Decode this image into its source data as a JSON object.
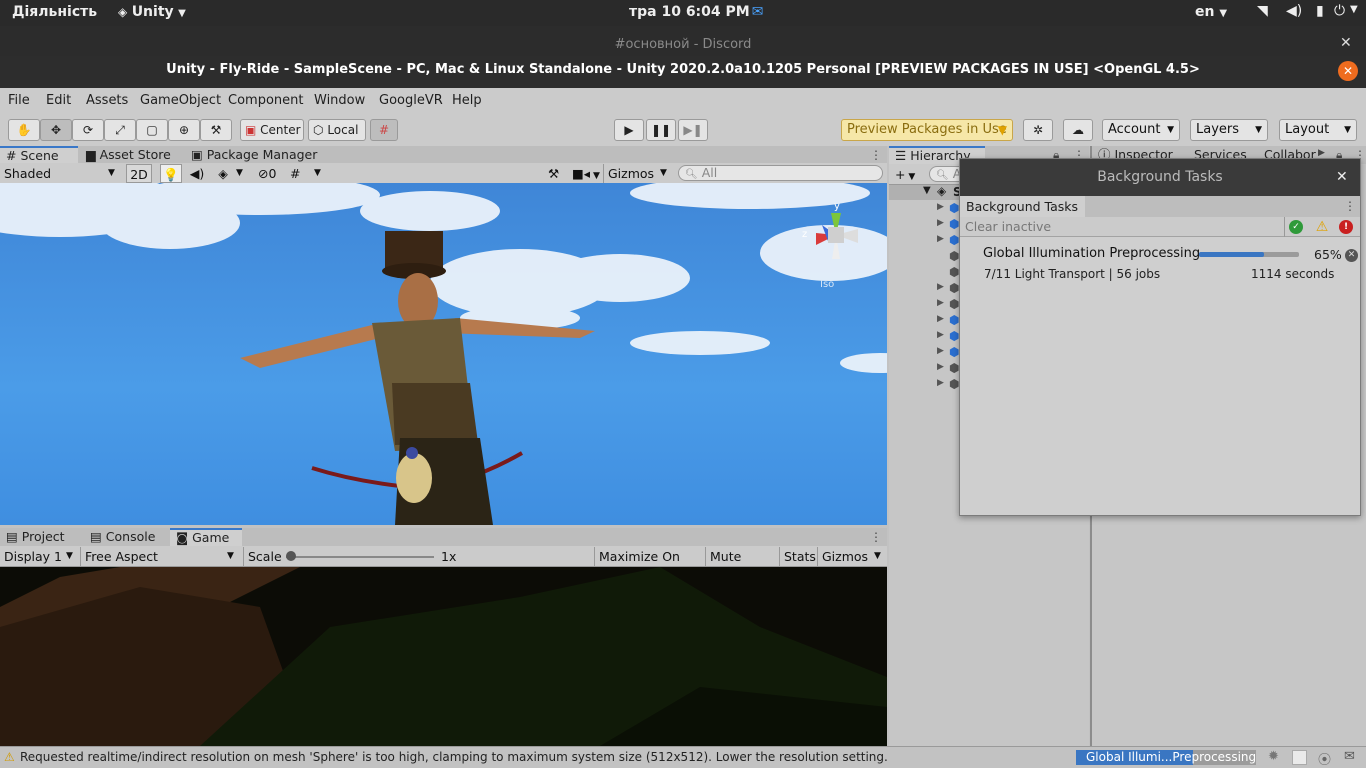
{
  "system_bar": {
    "activities": "Діяльність",
    "app_name": "Unity",
    "clock": "тра 10   6:04 PM",
    "language": "en",
    "tray_icons": [
      "wifi-icon",
      "volume-icon",
      "battery-icon",
      "power-icon"
    ]
  },
  "discord_window": {
    "title": "#основной - Discord",
    "close": "✕"
  },
  "window": {
    "title": "Unity - Fly-Ride - SampleScene - PC, Mac & Linux Standalone - Unity 2020.2.0a10.1205 Personal [PREVIEW PACKAGES IN USE] <OpenGL 4.5>",
    "close": "✕"
  },
  "menu": [
    "File",
    "Edit",
    "Assets",
    "GameObject",
    "Component",
    "Window",
    "GoogleVR",
    "Help"
  ],
  "toolbar": {
    "tools": [
      "hand-tool-icon",
      "move-tool-icon",
      "rotate-tool-icon",
      "scale-tool-icon",
      "rect-tool-icon",
      "transform-tool-icon",
      "custom-tool-icon"
    ],
    "pivot_mode": "Center",
    "pivot_rotation": "Local",
    "preview_packages": "Preview Packages in Use",
    "account": "Account",
    "layers": "Layers",
    "layout": "Layout"
  },
  "scene_panel": {
    "tabs": [
      "Scene",
      "Asset Store",
      "Package Manager"
    ],
    "draw_mode": "Shaded",
    "mode_2d": "2D",
    "hidden_count": "0",
    "gizmos": "Gizmos",
    "search_placeholder": "All",
    "gizmo_axes": {
      "y": "y",
      "z": "z"
    },
    "view_label": "Iso"
  },
  "game_panel": {
    "tabs": [
      "Project",
      "Console",
      "Game"
    ],
    "display": "Display 1",
    "aspect": "Free Aspect",
    "scale_label": "Scale",
    "scale_value": "1x",
    "scale_level": 0,
    "maximize": "Maximize On Play",
    "mute": "Mute Audio",
    "stats": "Stats",
    "gizmos": "Gizmos"
  },
  "hierarchy": {
    "tab": "Hierarchy",
    "add": "+",
    "search_placeholder": "All",
    "scene_initial": "S"
  },
  "inspector_tabs": [
    "Inspector",
    "Services",
    "Collabor"
  ],
  "background_tasks": {
    "title": "Background Tasks",
    "tab": "Background Tasks",
    "clear_inactive": "Clear inactive",
    "task": {
      "name": "Global Illumination Preprocessing",
      "progress": 0.65,
      "percent": "65%",
      "details": "7/11 Light Transport | 56 jobs",
      "time": "1114 seconds"
    }
  },
  "status_bar": {
    "message": "Requested realtime/indirect resolution on mesh 'Sphere' is too high, clamping to maximum system size (512x512). Lower the resolution setting.",
    "progress_label": "Global Illumi...Preprocessing",
    "progress": 0.65
  }
}
